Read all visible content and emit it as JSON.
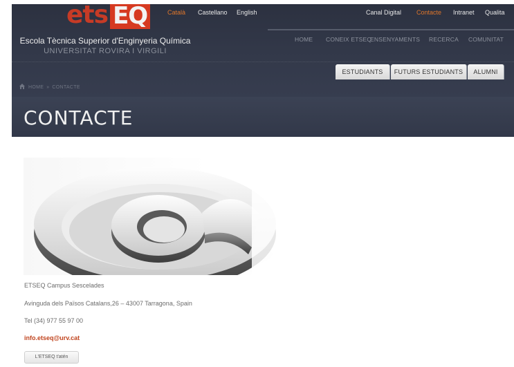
{
  "logo": {
    "part1": "ets",
    "part2": "EQ"
  },
  "languages": [
    "Català",
    "Castellano",
    "English"
  ],
  "top_links": [
    "Canal Digital",
    "Contacte",
    "Intranet",
    "Qualita"
  ],
  "school": {
    "name": "Escola Tècnica Superior d'Enginyeria Química",
    "university": "UNIVERSITAT ROVIRA I VIRGILI"
  },
  "main_nav": [
    "HOME",
    "CONEIX ETSEQ",
    "ENSENYAMENTS",
    "RECERCA",
    "COMUNITAT"
  ],
  "tabs": [
    "ESTUDIANTS",
    "FUTURS ESTUDIANTS",
    "ALUMNI"
  ],
  "breadcrumb": {
    "home": "HOME",
    "separator": "»",
    "current": "CONTACTE"
  },
  "page_title": "CONTACTE",
  "contact": {
    "campus": "ETSEQ Campus Sescelades",
    "address": "Avinguda dels Països Catalans,26 – 43007 Tarragona, Spain",
    "phone": "Tel (34) 977 55 97 00",
    "email": "info.etseq@urv.cat",
    "button_label": "L'ETSEQ t'atén"
  },
  "colors": {
    "brand_red": "#d63a21",
    "accent_orange": "#e0762a",
    "header_bg": "#33394a"
  }
}
